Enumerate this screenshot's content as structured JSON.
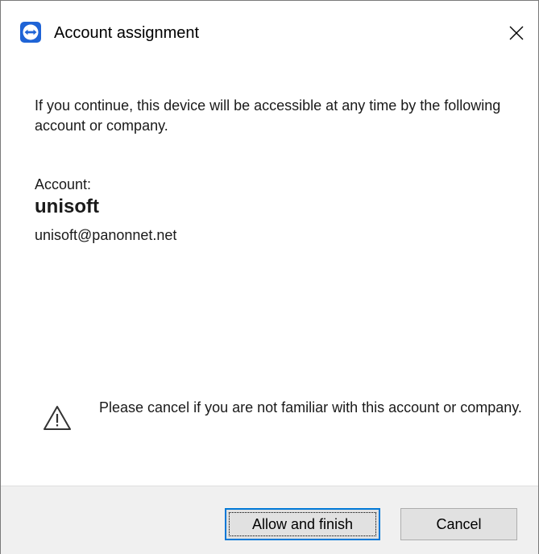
{
  "window": {
    "title": "Account assignment",
    "app_icon": "teamviewer-logo-icon",
    "close_icon": "close-icon"
  },
  "content": {
    "message": "If you continue, this device will be accessible at any time by the following account or company.",
    "account_label": "Account:",
    "account_name": "unisoft",
    "account_email": "unisoft@panonnet.net",
    "warning_icon": "warning-triangle-icon",
    "warning_message": "Please cancel if you are not familiar with this account or company."
  },
  "footer": {
    "allow_label": "Allow and finish",
    "cancel_label": "Cancel"
  },
  "colors": {
    "accent": "#0078d7",
    "app_icon_bg": "#1f64d6",
    "footer_bg": "#f0f0f0",
    "button_bg": "#e1e1e1"
  }
}
